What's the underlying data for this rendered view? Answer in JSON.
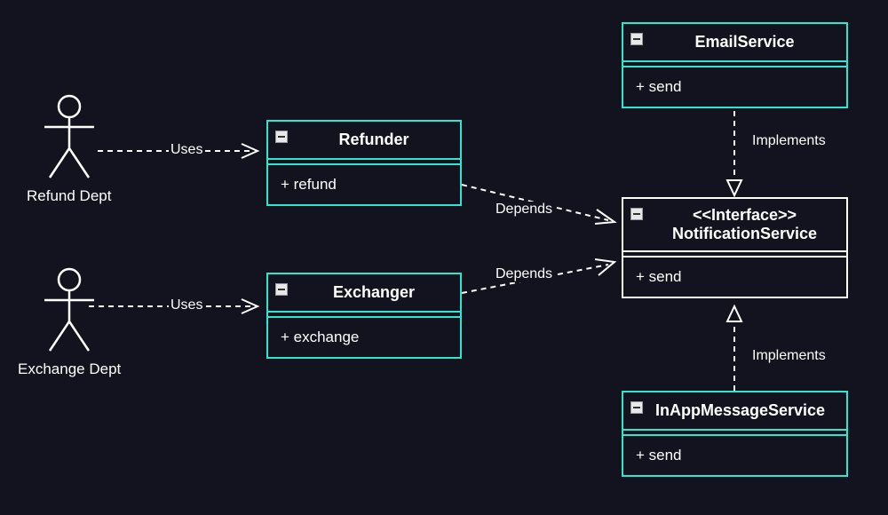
{
  "actors": {
    "refund": {
      "label": "Refund Dept"
    },
    "exchange": {
      "label": "Exchange Dept"
    }
  },
  "classes": {
    "refunder": {
      "name": "Refunder",
      "method": "+ refund"
    },
    "exchanger": {
      "name": "Exchanger",
      "method": "+ exchange"
    },
    "emailService": {
      "name": "EmailService",
      "method": "+ send"
    },
    "notificationService": {
      "stereotype": "<<Interface>>",
      "name": "NotificationService",
      "method": "+ send"
    },
    "inAppMessageService": {
      "name": "InAppMessageService",
      "method": "+ send"
    }
  },
  "edges": {
    "uses1": "Uses",
    "uses2": "Uses",
    "depends1": "Depends",
    "depends2": "Depends",
    "implements1": "Implements",
    "implements2": "Implements"
  }
}
